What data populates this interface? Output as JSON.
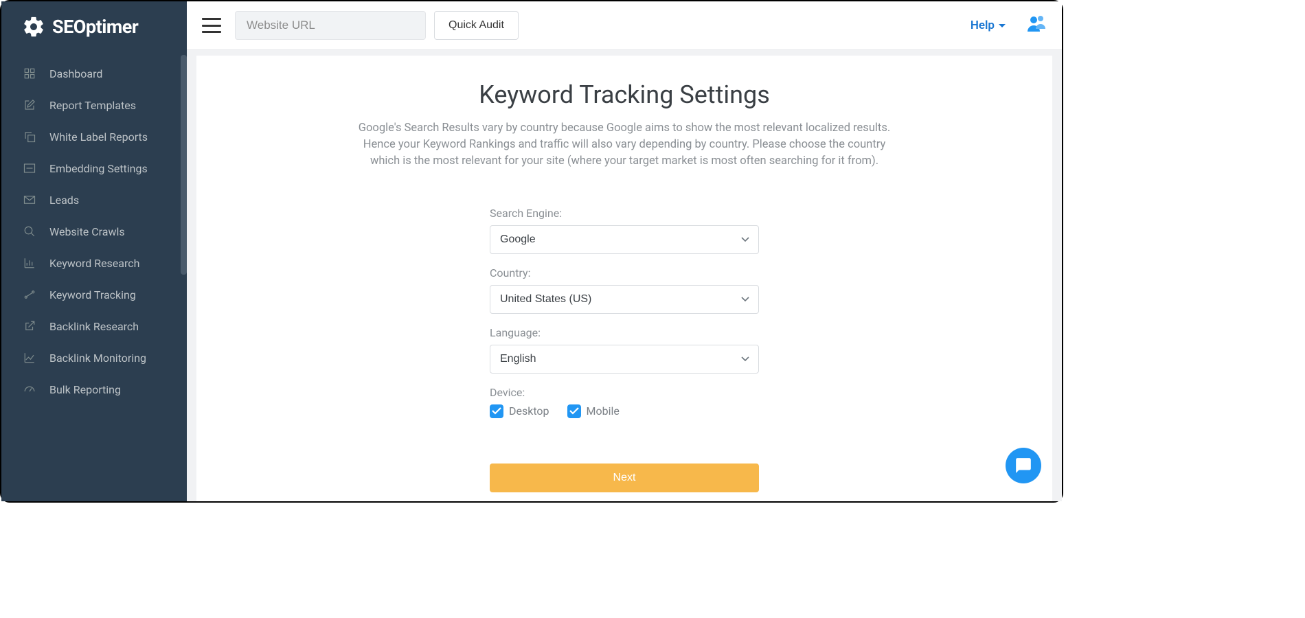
{
  "brand": {
    "name": "SEOptimer"
  },
  "sidebar": {
    "items": [
      {
        "label": "Dashboard"
      },
      {
        "label": "Report Templates"
      },
      {
        "label": "White Label Reports"
      },
      {
        "label": "Embedding Settings"
      },
      {
        "label": "Leads"
      },
      {
        "label": "Website Crawls"
      },
      {
        "label": "Keyword Research"
      },
      {
        "label": "Keyword Tracking"
      },
      {
        "label": "Backlink Research"
      },
      {
        "label": "Backlink Monitoring"
      },
      {
        "label": "Bulk Reporting"
      }
    ]
  },
  "topbar": {
    "url_placeholder": "Website URL",
    "quick_audit": "Quick Audit",
    "help": "Help"
  },
  "page": {
    "title": "Keyword Tracking Settings",
    "description": "Google's Search Results vary by country because Google aims to show the most relevant localized results. Hence your Keyword Rankings and traffic will also vary depending by country. Please choose the country which is the most relevant for your site (where your target market is most often searching for it from)."
  },
  "form": {
    "search_engine": {
      "label": "Search Engine:",
      "value": "Google"
    },
    "country": {
      "label": "Country:",
      "value": "United States (US)"
    },
    "language": {
      "label": "Language:",
      "value": "English"
    },
    "device": {
      "label": "Device:",
      "desktop": "Desktop",
      "mobile": "Mobile"
    },
    "next": "Next"
  }
}
